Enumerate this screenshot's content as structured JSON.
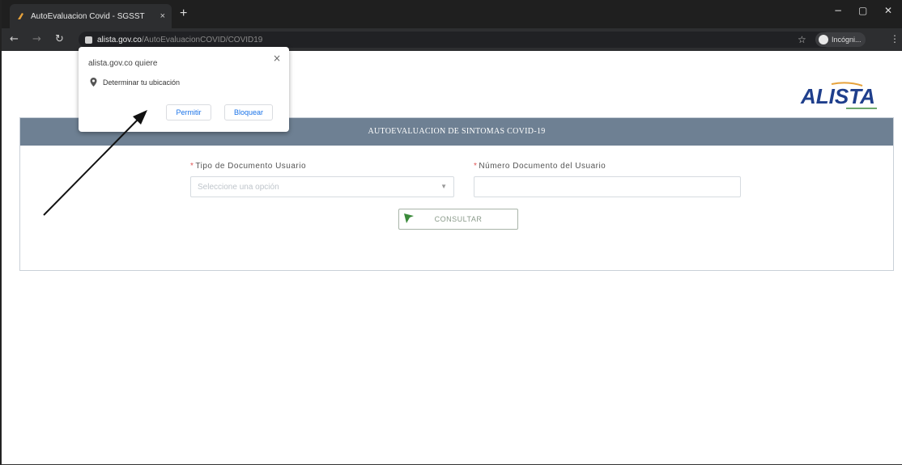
{
  "browser": {
    "tab_title": "AutoEvaluacion Covid - SGSST",
    "tab_close": "×",
    "new_tab": "+",
    "minimize": "−",
    "maximize": "▢",
    "close": "✕",
    "back": "←",
    "forward": "→",
    "reload": "↻",
    "url_host": "alista.gov.co",
    "url_path": "/AutoEvaluacionCOVID/COVID19",
    "star": "☆",
    "profile_label": "Incógni...",
    "menu": "⋮"
  },
  "popup": {
    "title": "alista.gov.co quiere",
    "close": "×",
    "permission": "Determinar tu ubicación",
    "allow_label": "Permitir",
    "block_label": "Bloquear"
  },
  "page": {
    "logo_text": "ALISTA",
    "panel_title": "AUTOEVALUACION DE SINTOMAS COVID-19",
    "doc_type_label": "Tipo de Documento Usuario",
    "doc_type_required": "*",
    "doc_type_placeholder": "Seleccione una opción",
    "doc_number_label": "Número Documento del Usuario",
    "doc_number_required": "*",
    "doc_number_value": "",
    "consult_label": "CONSULTAR"
  },
  "colors": {
    "panel_header": "#6e8093",
    "logo_blue": "#1f3f8c",
    "accent_green": "#3a8a3a",
    "required": "#e05555"
  }
}
